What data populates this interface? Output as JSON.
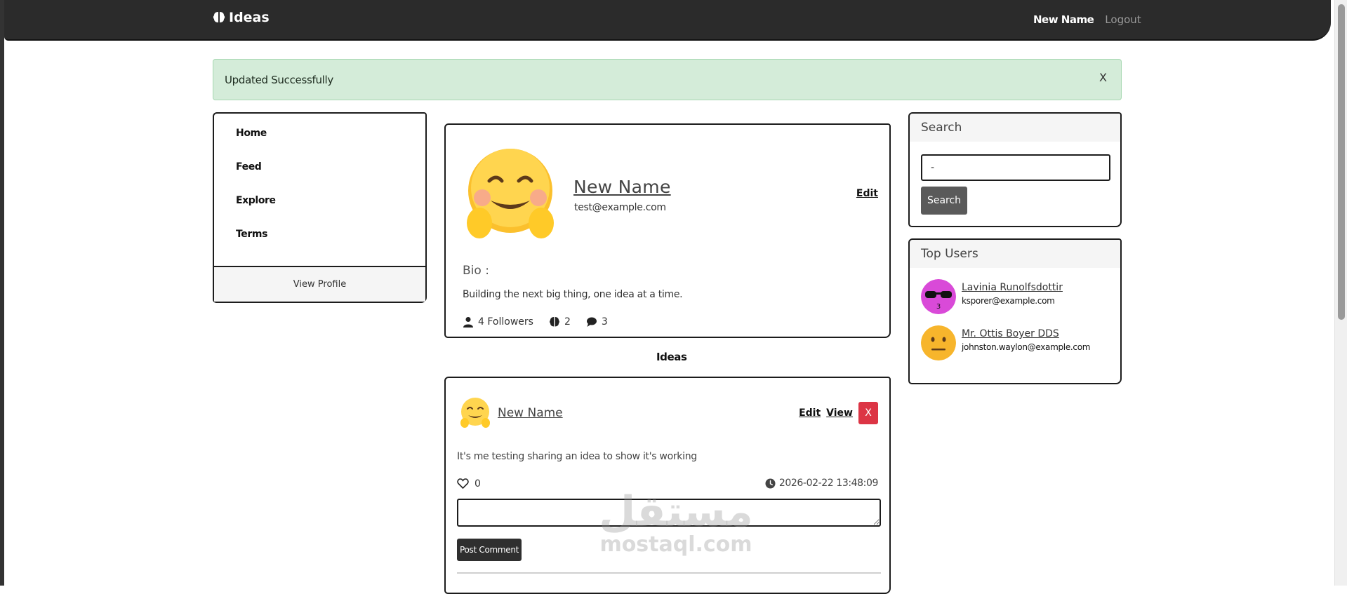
{
  "navbar": {
    "brand": "Ideas",
    "brand_icon": "brain-icon",
    "user_name": "New Name",
    "logout_label": "Logout"
  },
  "alert": {
    "message": "Updated Successfully",
    "close_label": "X"
  },
  "menu": {
    "items": [
      {
        "label": "Home"
      },
      {
        "label": "Feed"
      },
      {
        "label": "Explore"
      },
      {
        "label": "Terms"
      }
    ],
    "footer_label": "View Profile"
  },
  "profile": {
    "avatar_icon": "smiling-hug-emoji",
    "name": "New Name",
    "email": "test@example.com",
    "edit_label": "Edit",
    "bio_label": "Bio :",
    "bio_text": "Building the next big thing, one idea at a time.",
    "followers_text": "4 Followers",
    "ideas_count": "2",
    "comments_count": "3"
  },
  "ideas_heading": "Ideas",
  "idea": {
    "author": "New Name",
    "edit_label": "Edit",
    "view_label": "View",
    "delete_label": "X",
    "content": "It's me testing sharing an idea to show it's working",
    "likes": "0",
    "timestamp": "2026-02-22 13:48:09",
    "comment_placeholder": "",
    "post_button": "Post Comment"
  },
  "search": {
    "title": "Search",
    "input_value": "-",
    "button_label": "Search"
  },
  "top_users": {
    "title": "Top Users",
    "users": [
      {
        "name": "Lavinia Runolfsdottir",
        "email": "ksporer@example.com",
        "avatar_color": "#d94ad8",
        "avatar_icon": "sunglasses-emoji"
      },
      {
        "name": "Mr. Ottis Boyer DDS",
        "email": "johnston.waylon@example.com",
        "avatar_color": "#f7b52c",
        "avatar_icon": "neutral-face-emoji"
      }
    ]
  },
  "watermark": {
    "arabic": "مستقل",
    "latin": "mostaql.com"
  },
  "colors": {
    "navbar": "#2b2b2b",
    "alert_bg": "#d4ecd9",
    "delete": "#dc3545",
    "button_dark": "#2f2f2f"
  }
}
